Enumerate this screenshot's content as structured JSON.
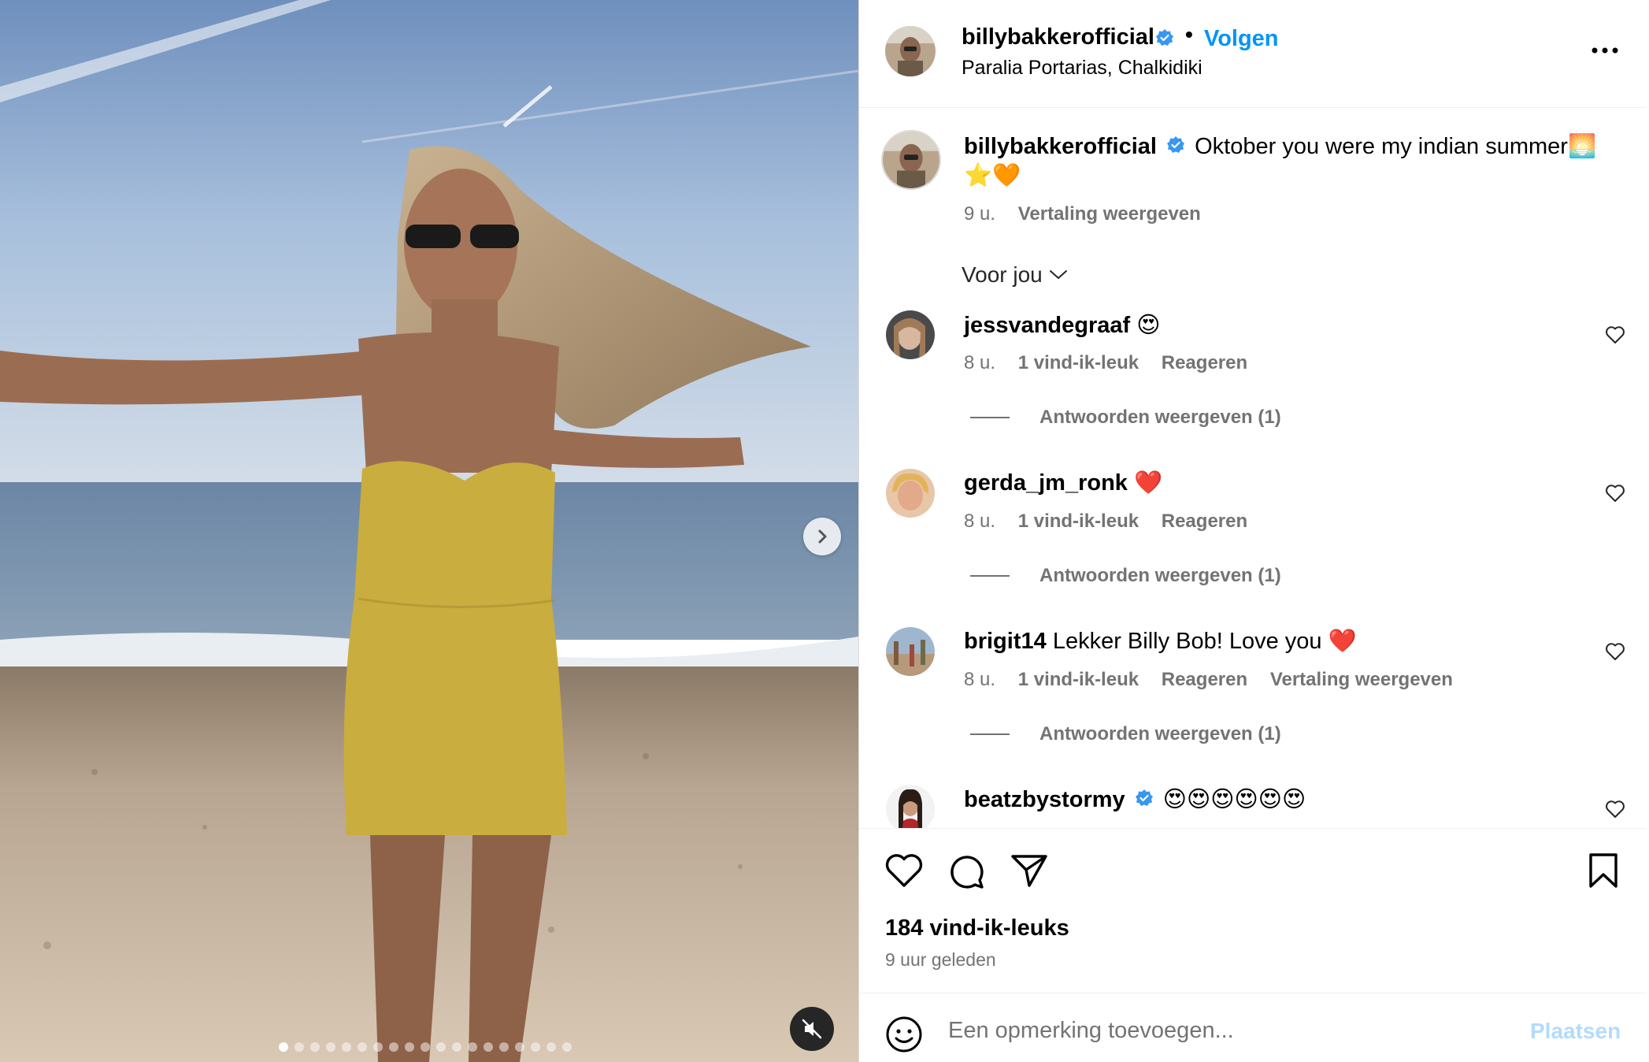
{
  "post": {
    "username": "billybakkerofficial",
    "verified": true,
    "follow_label": "Volgen",
    "separator": "•",
    "location": "Paralia Portarias, Chalkidiki",
    "more_icon": "more-horizontal-icon"
  },
  "caption": {
    "username": "billybakkerofficial",
    "text": "Oktober you were my indian summer🌅⭐️🧡",
    "time": "9 u.",
    "translate_label": "Vertaling weergeven"
  },
  "sort": {
    "label": "Voor jou",
    "icon": "chevron-down-icon"
  },
  "comments": [
    {
      "username": "jessvandegraaf",
      "verified": false,
      "text": "😍",
      "time": "8 u.",
      "likes": "1 vind-ik-leuk",
      "reply_label": "Reageren",
      "translate_label": "",
      "replies_label": "Antwoorden weergeven (1)"
    },
    {
      "username": "gerda_jm_ronk",
      "verified": false,
      "text": "❤️",
      "time": "8 u.",
      "likes": "1 vind-ik-leuk",
      "reply_label": "Reageren",
      "translate_label": "",
      "replies_label": "Antwoorden weergeven (1)"
    },
    {
      "username": "brigit14",
      "verified": false,
      "text": "Lekker Billy Bob! Love you ❤️",
      "time": "8 u.",
      "likes": "1 vind-ik-leuk",
      "reply_label": "Reageren",
      "translate_label": "Vertaling weergeven",
      "replies_label": "Antwoorden weergeven (1)"
    },
    {
      "username": "beatzbystormy",
      "verified": true,
      "text": "😍😍😍😍😍😍",
      "time": "",
      "likes": "",
      "reply_label": "",
      "translate_label": "",
      "replies_label": ""
    }
  ],
  "actions": {
    "icons": [
      "heart-icon",
      "comment-icon",
      "share-icon",
      "bookmark-icon"
    ],
    "likes_count": "184 vind-ik-leuks",
    "time_ago": "9 uur geleden"
  },
  "composer": {
    "placeholder": "Een opmerking toevoegen...",
    "post_label": "Plaatsen",
    "emoji_icon": "emoji-icon"
  },
  "media": {
    "carousel_count": 19,
    "carousel_active_index": 0,
    "next_icon": "chevron-right-icon",
    "mute_icon": "speaker-muted-icon"
  },
  "colors": {
    "accent": "#0095f6",
    "verified_badge": "#3897f0",
    "secondary_text": "#737373",
    "post_disabled": "#b3dbff"
  }
}
